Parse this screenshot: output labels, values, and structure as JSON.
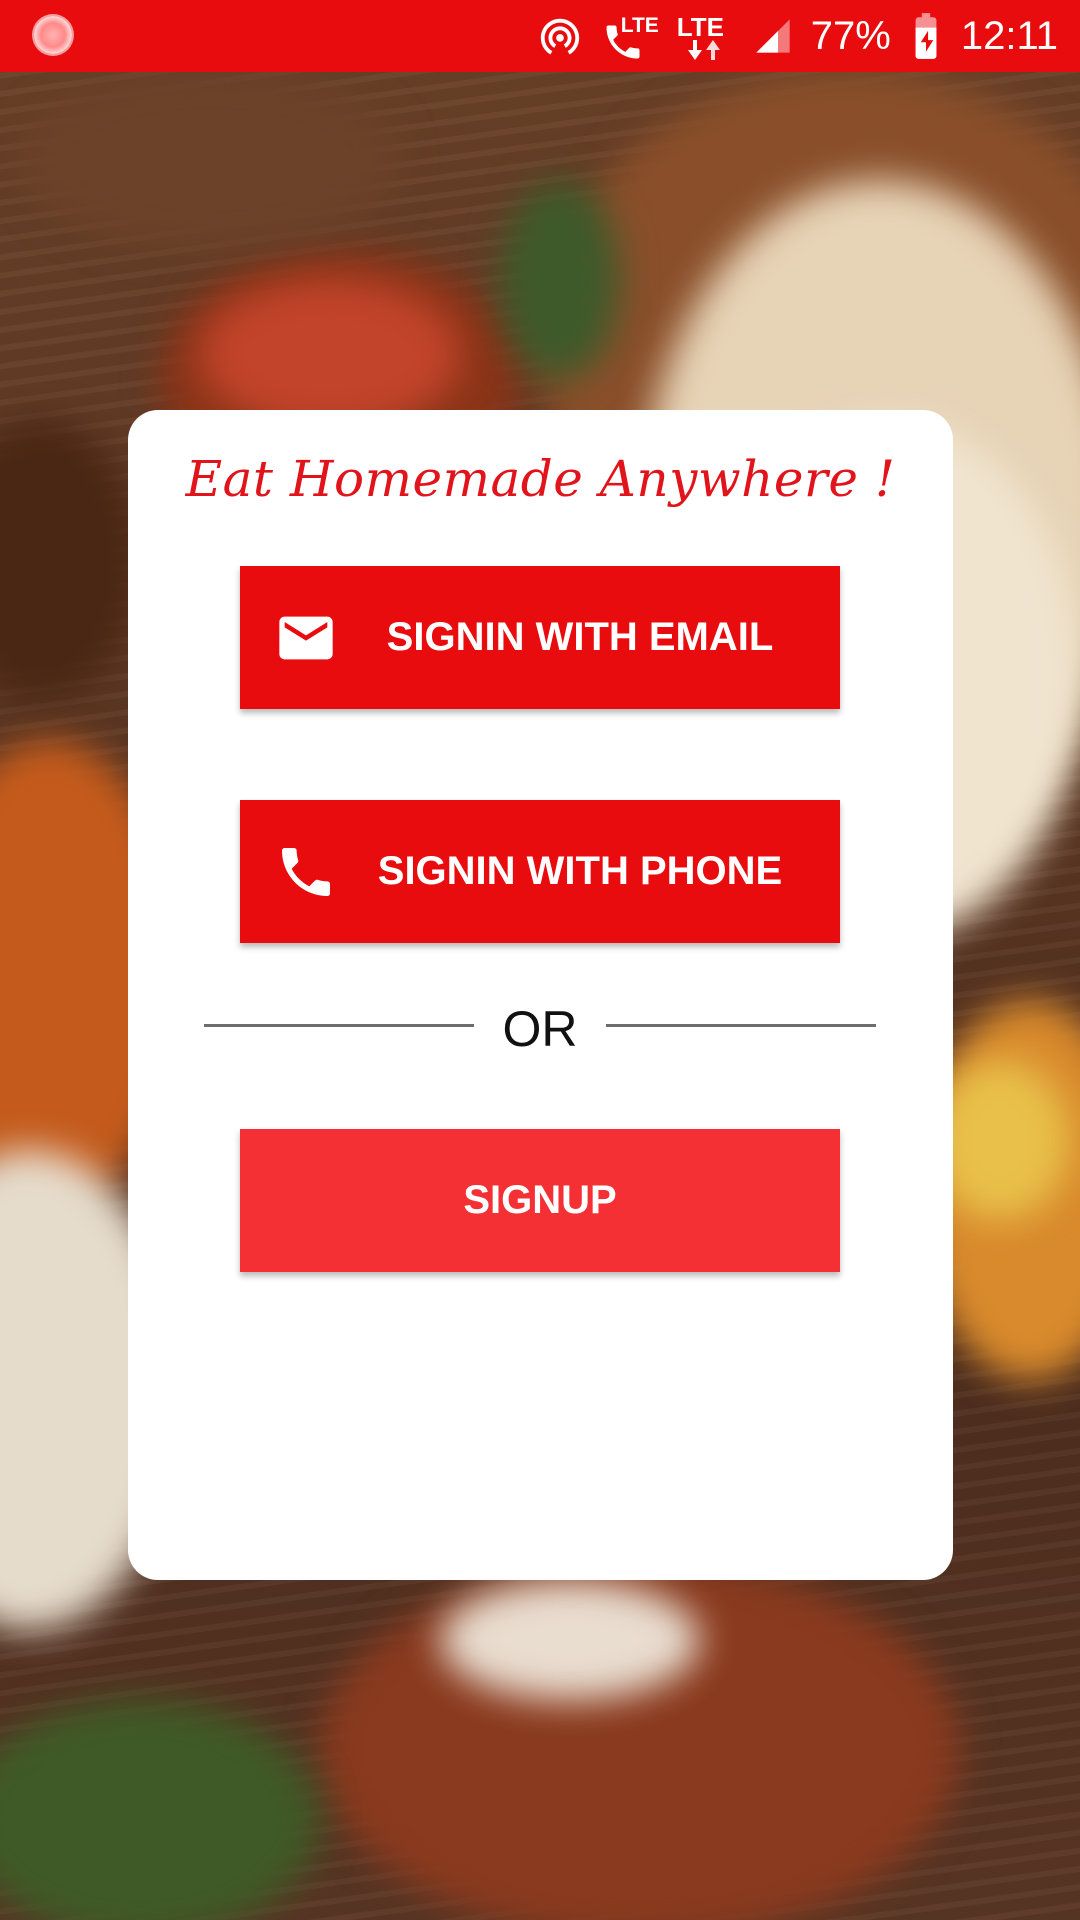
{
  "status_bar": {
    "lte_label_1": "LTE",
    "lte_label_2": "LTE",
    "battery_percent": "77%",
    "time": "12:11",
    "icons": [
      "app-notification-icon",
      "hotspot-icon",
      "volte-call-icon",
      "lte-data-icon",
      "signal-icon",
      "battery-charging-icon"
    ]
  },
  "card": {
    "tagline": "Eat Homemade Anywhere !",
    "email_button": {
      "label": "SIGNIN WITH EMAIL",
      "icon": "mail-icon"
    },
    "phone_button": {
      "label": "SIGNIN WITH PHONE",
      "icon": "phone-icon"
    },
    "divider_text": "OR",
    "signup_button": {
      "label": "SIGNUP"
    }
  },
  "colors": {
    "primary_red": "#e90c0f",
    "signup_red": "#f43034",
    "tagline_red": "#e0141a",
    "card_bg": "#ffffff"
  }
}
